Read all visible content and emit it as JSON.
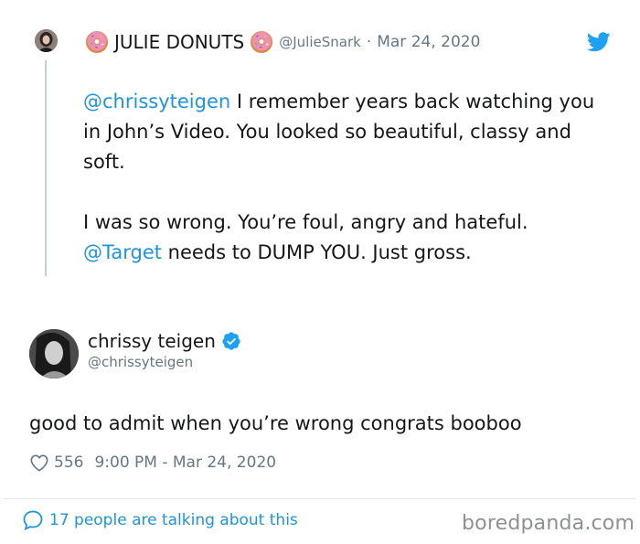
{
  "parent_tweet": {
    "avatar_icon": "woman-avatar-icon",
    "name_prefix_emoji": "donut-emoji",
    "display_name": "JULIE DONUTS",
    "name_suffix_emoji": "donut-emoji",
    "handle": "@JulieSnark",
    "separator": "·",
    "date": "Mar 24, 2020",
    "body_line1_mention": "@chrissyteigen",
    "body_line1_rest": " I remember years back watching you in John’s Video. You looked so beautiful, classy and soft.",
    "body_line2_text": "I was so wrong. You’re foul, angry and hateful.",
    "body_line3_mention": "@Target",
    "body_line3_rest": " needs to DUMP YOU. Just gross."
  },
  "reply_tweet": {
    "avatar_icon": "profile-photo-icon",
    "display_name": "chrissy teigen",
    "verified_icon": "verified-badge-icon",
    "handle": "@chrissyteigen",
    "text": "good to admit when you’re wrong congrats booboo",
    "likes": "556",
    "time": "9:00 PM - Mar 24, 2020"
  },
  "footer": {
    "talking": "17 people are talking about this"
  },
  "watermark": "boredpanda.com",
  "colors": {
    "link": "#1b95e0",
    "secondary_text": "#657786",
    "primary_text": "#14171a",
    "verified": "#1da1f2",
    "divider": "#e1e8ed"
  }
}
